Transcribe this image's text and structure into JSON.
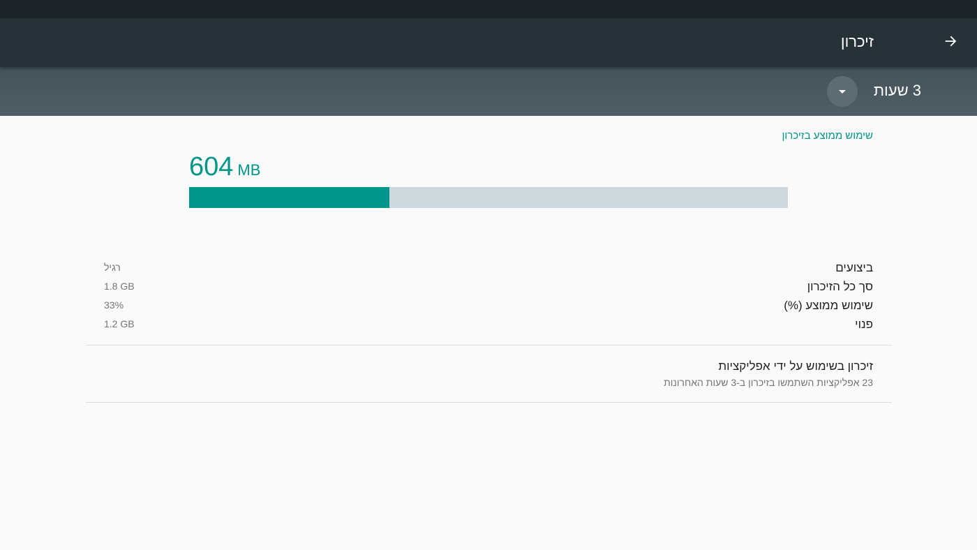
{
  "app_bar": {
    "title": "זיכרון",
    "back_icon": "arrow-forward-icon"
  },
  "filter": {
    "period_label": "3 שעות",
    "dropdown_icon": "arrow-drop-down-icon"
  },
  "average_usage": {
    "heading": "שימוש ממוצע בזיכרון",
    "value": "604",
    "unit": "MB",
    "fraction_used": 0.334
  },
  "stats": [
    {
      "label": "ביצועים",
      "value": "רגיל"
    },
    {
      "label": "סך כל הזיכרון",
      "value": "1.8 GB"
    },
    {
      "label": "שימוש ממוצע (%)",
      "value": "33%"
    },
    {
      "label": "פנוי",
      "value": "1.2 GB"
    }
  ],
  "apps_item": {
    "title": "זיכרון בשימוש על ידי אפליקציות",
    "subtitle": "23 אפליקציות השתמשו בזיכרון ב-3 שעות האחרונות"
  },
  "colors": {
    "accent": "#00968a",
    "app_bar": "#263238",
    "filter_bar": "#4f5e66",
    "bar_track": "#cfd8dc",
    "background": "#fafafa"
  }
}
